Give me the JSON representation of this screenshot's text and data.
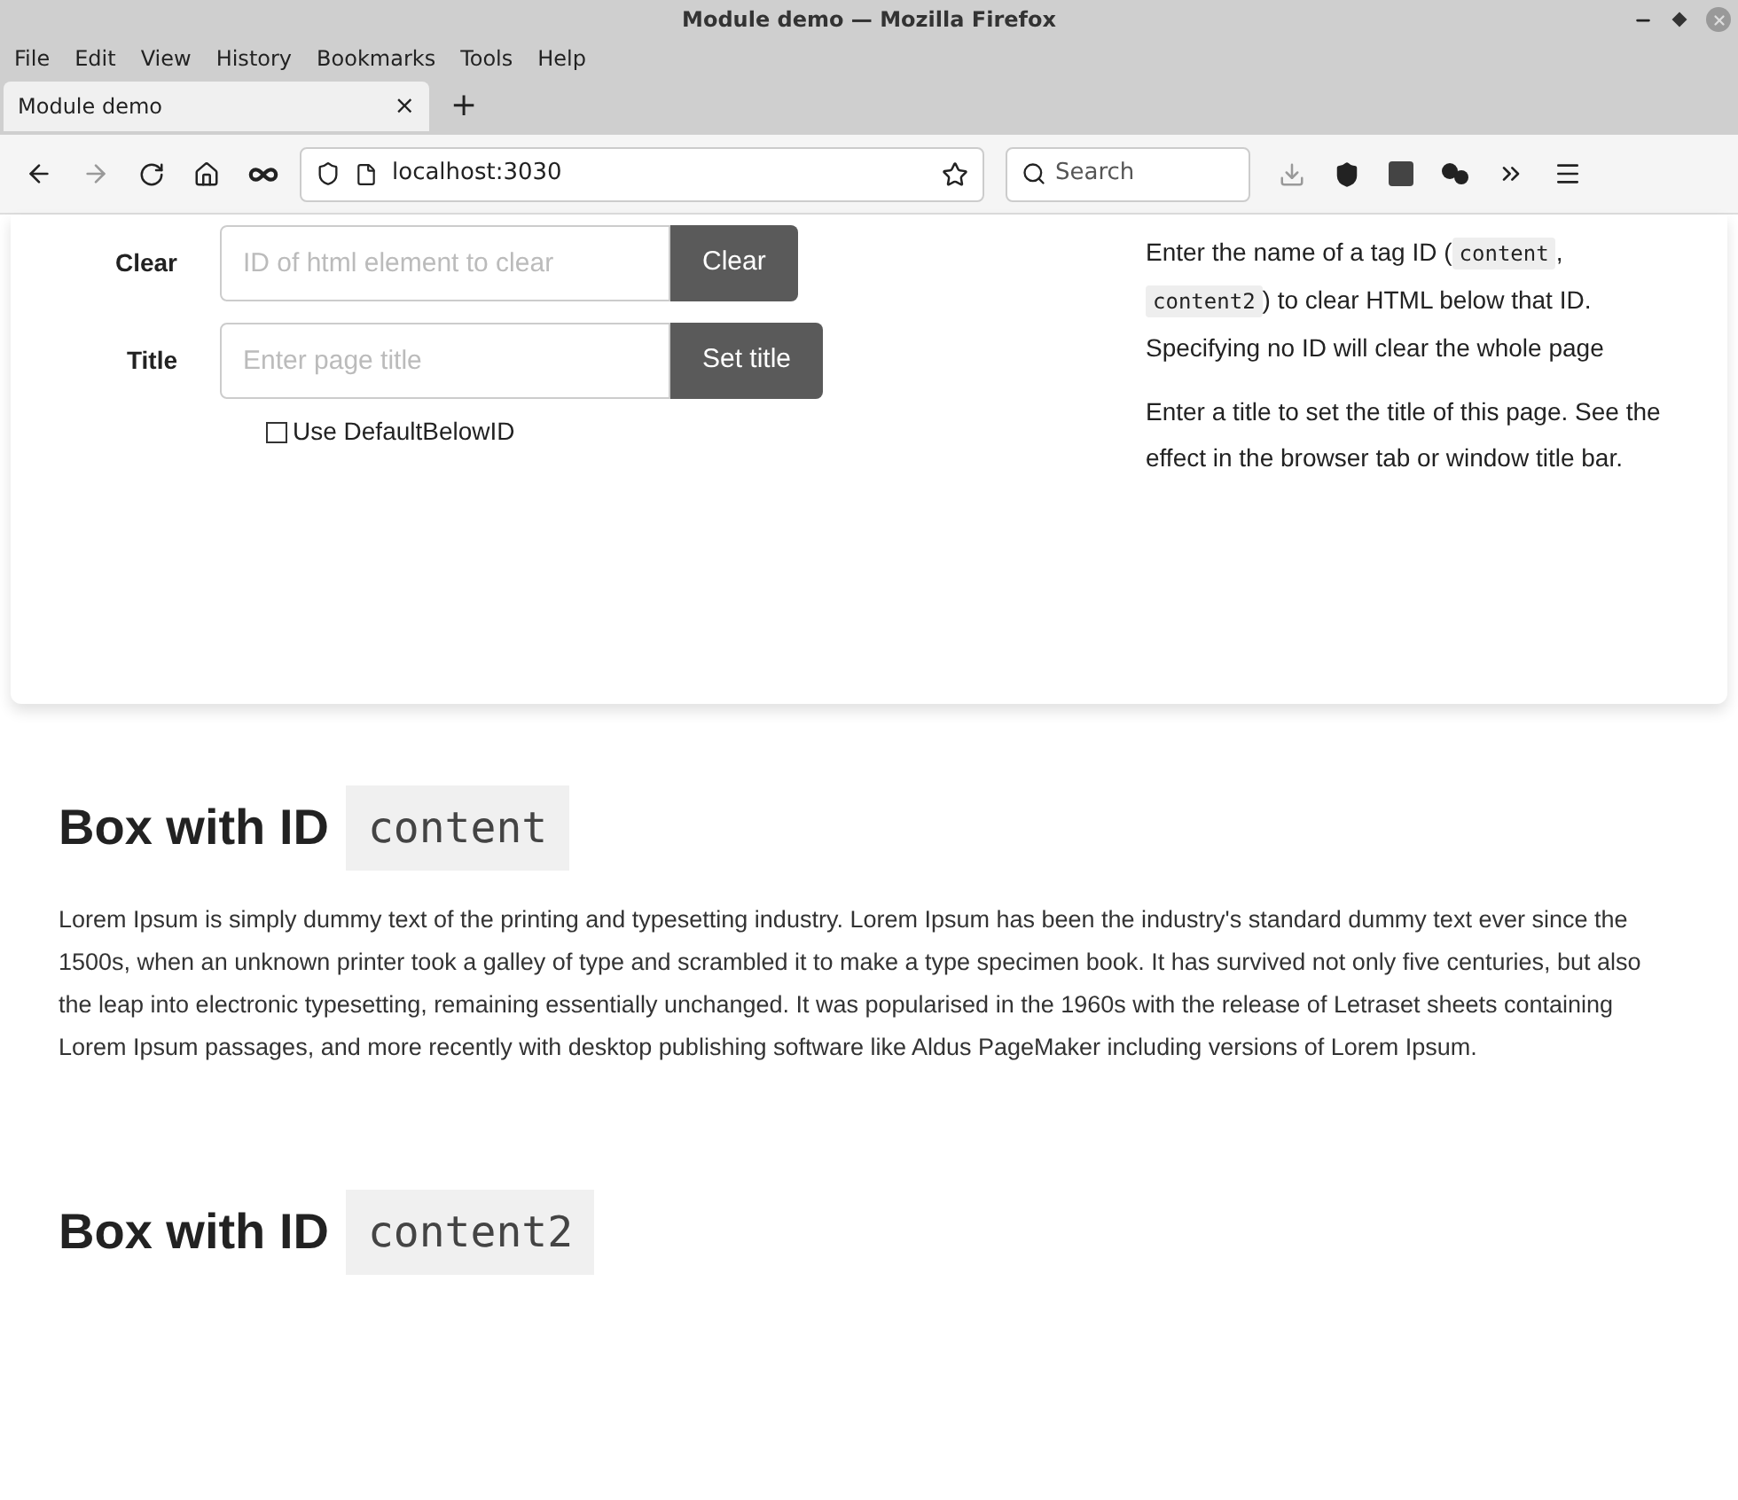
{
  "window": {
    "title": "Module demo — Mozilla Firefox"
  },
  "menu": [
    "File",
    "Edit",
    "View",
    "History",
    "Bookmarks",
    "Tools",
    "Help"
  ],
  "tabs": [
    {
      "label": "Module demo",
      "selected": true,
      "close": "×"
    }
  ],
  "new_tab": "+",
  "address": "localhost:3030",
  "search": {
    "placeholder": "Search"
  },
  "form": {
    "rows": [
      {
        "label": "Clear",
        "placeholder": "ID of html element to clear",
        "button": "Clear"
      },
      {
        "label": "Title",
        "placeholder": "Enter page title",
        "button": "Set title"
      }
    ],
    "checkbox": {
      "label": "Use DefaultBelowID",
      "checked": false
    }
  },
  "help": [
    [
      {
        "kind": "text",
        "text": "Enter the name of a tag ID ("
      },
      {
        "kind": "code",
        "text": "content"
      },
      {
        "kind": "text",
        "text": ", "
      },
      {
        "kind": "code",
        "text": "content2"
      },
      {
        "kind": "text",
        "text": ") to clear HTML below that ID. Specifying no ID will clear the whole page"
      }
    ],
    [
      {
        "kind": "text",
        "text": "Enter a title to set the title of this page. See the effect in the browser tab or window title bar."
      }
    ]
  ],
  "sections": [
    {
      "heading": "Box with ID",
      "id": "content",
      "text": "Lorem Ipsum is simply dummy text of the printing and typesetting industry. Lorem Ipsum has been the industry's standard dummy text ever since the 1500s, when an unknown printer took a galley of type and scrambled it to make a type specimen book. It has survived not only five centuries, but also the leap into electronic typesetting, remaining essentially unchanged. It was popularised in the 1960s with the release of Letraset sheets containing Lorem Ipsum passages, and more recently with desktop publishing software like Aldus PageMaker including versions of Lorem Ipsum."
    },
    {
      "heading": "Box with ID",
      "id": "content2"
    }
  ]
}
